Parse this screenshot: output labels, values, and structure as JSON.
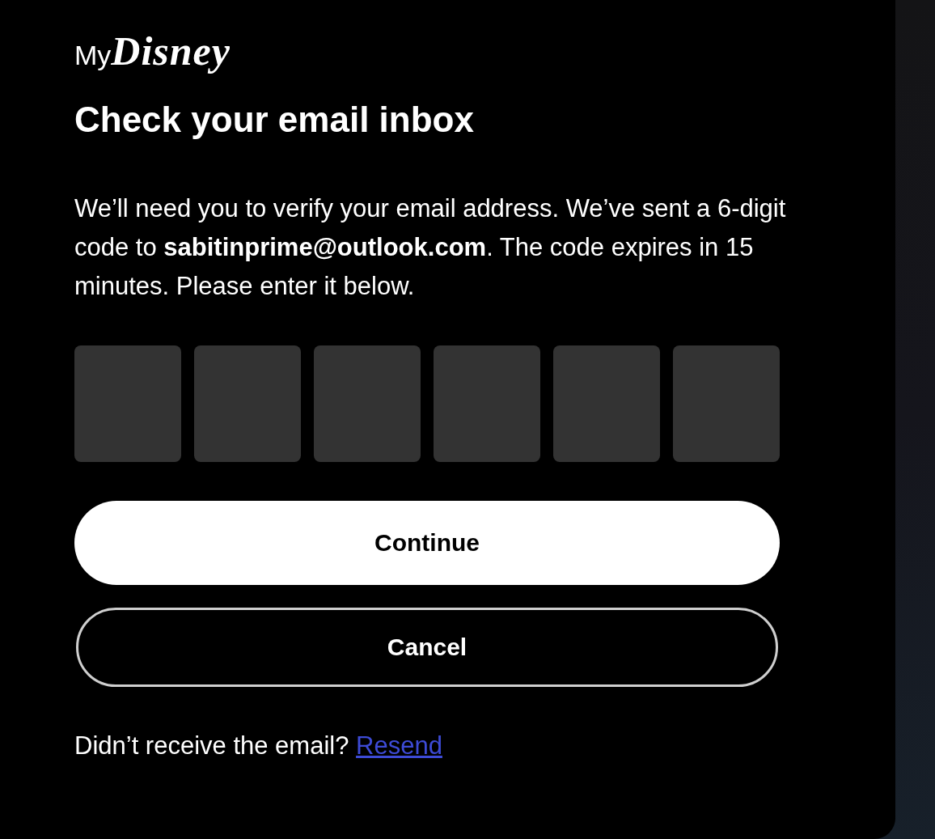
{
  "logo": {
    "prefix": "My",
    "name": "Disney"
  },
  "heading": "Check your email inbox",
  "message": "We’ll need you to verify your email address. We’ve sent a 6-digit code to **sabitinprime@outlook.com**. The code expires in 15 minutes. Please enter it below.",
  "code_fields": [
    {
      "kind": "digit"
    },
    {
      "kind": "digit"
    },
    {
      "kind": "digit"
    },
    {
      "kind": "digit"
    },
    {
      "kind": "digit"
    },
    {
      "kind": "digit"
    }
  ],
  "buttons": [
    {
      "label": "Continue",
      "kind": "primary"
    },
    {
      "label": "Cancel",
      "kind": "secondary"
    }
  ],
  "resend_prompt": {
    "text": "Didn’t receive the email?",
    "link": "Resend"
  }
}
